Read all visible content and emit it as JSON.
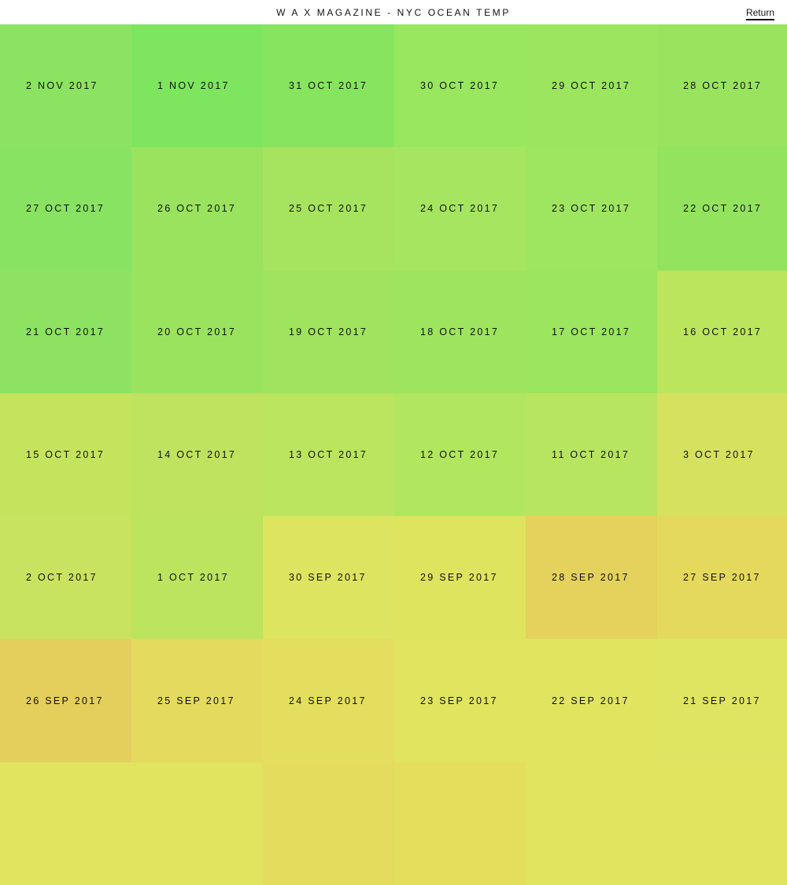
{
  "header": {
    "title": "W A X MAGAZINE - NYC OCEAN TEMP",
    "return_label": "Return"
  },
  "tiles": [
    {
      "date": "2 NOV 2017",
      "color": "#8ce362"
    },
    {
      "date": "1 NOV 2017",
      "color": "#7ee55f"
    },
    {
      "date": "31 OCT 2017",
      "color": "#87e45f"
    },
    {
      "date": "30 OCT 2017",
      "color": "#99e65f"
    },
    {
      "date": "29 OCT 2017",
      "color": "#9be55f"
    },
    {
      "date": "28 OCT 2017",
      "color": "#9ae35f"
    },
    {
      "date": "27 OCT 2017",
      "color": "#89e363"
    },
    {
      "date": "26 OCT 2017",
      "color": "#99e35f"
    },
    {
      "date": "25 OCT 2017",
      "color": "#a6e45f"
    },
    {
      "date": "24 OCT 2017",
      "color": "#a6e560"
    },
    {
      "date": "23 OCT 2017",
      "color": "#9ee560"
    },
    {
      "date": "22 OCT 2017",
      "color": "#93e35f"
    },
    {
      "date": "21 OCT 2017",
      "color": "#8de261"
    },
    {
      "date": "20 OCT 2017",
      "color": "#9ae35f"
    },
    {
      "date": "19 OCT 2017",
      "color": "#a0e35f"
    },
    {
      "date": "18 OCT 2017",
      "color": "#9fe45f"
    },
    {
      "date": "17 OCT 2017",
      "color": "#9ce55e"
    },
    {
      "date": "16 OCT 2017",
      "color": "#bce55e"
    },
    {
      "date": "15 OCT 2017",
      "color": "#c4e45e"
    },
    {
      "date": "14 OCT 2017",
      "color": "#bfe35e"
    },
    {
      "date": "13 OCT 2017",
      "color": "#bbe55e"
    },
    {
      "date": "12 OCT 2017",
      "color": "#b1e65f"
    },
    {
      "date": "11 OCT 2017",
      "color": "#b8e55f"
    },
    {
      "date": "3 OCT 2017",
      "color": "#d6e25f"
    },
    {
      "date": "2 OCT 2017",
      "color": "#c8e35f"
    },
    {
      "date": "1 OCT 2017",
      "color": "#bce45f"
    },
    {
      "date": "30 SEP 2017",
      "color": "#dde45f"
    },
    {
      "date": "29 SEP 2017",
      "color": "#dfe45e"
    },
    {
      "date": "28 SEP 2017",
      "color": "#e4d25c"
    },
    {
      "date": "27 SEP 2017",
      "color": "#e4d95d"
    },
    {
      "date": "26 SEP 2017",
      "color": "#e4ce5c"
    },
    {
      "date": "25 SEP 2017",
      "color": "#e4da5d"
    },
    {
      "date": "24 SEP 2017",
      "color": "#e4de5e"
    },
    {
      "date": "23 SEP 2017",
      "color": "#e0e45f"
    },
    {
      "date": "22 SEP 2017",
      "color": "#e0e45f"
    },
    {
      "date": "21 SEP 2017",
      "color": "#dfe560"
    },
    {
      "date": "",
      "color": "#e0e45f"
    },
    {
      "date": "",
      "color": "#e0e45f"
    },
    {
      "date": "",
      "color": "#e4dc5d"
    },
    {
      "date": "",
      "color": "#e4de5d"
    },
    {
      "date": "",
      "color": "#e0e45f"
    },
    {
      "date": "",
      "color": "#e0e45f"
    }
  ]
}
